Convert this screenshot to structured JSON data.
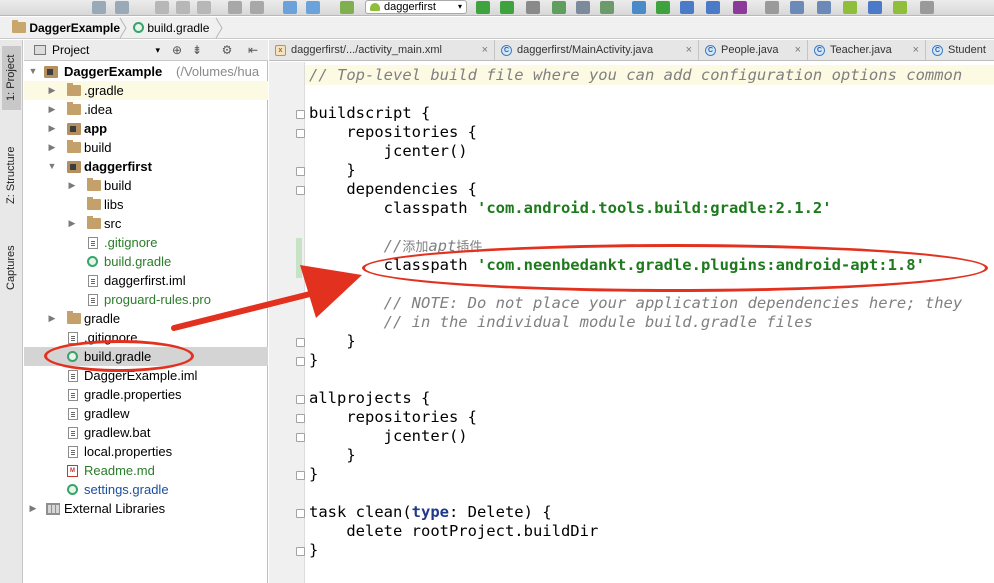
{
  "toolbar": {
    "run_config": "daggerfirst"
  },
  "breadcrumb": {
    "items": [
      "DaggerExample",
      "build.gradle"
    ]
  },
  "tool_strip": {
    "tabs": [
      "1: Project",
      "Z: Structure",
      "Captures"
    ]
  },
  "project_panel": {
    "view_selector": "Project",
    "tree": [
      {
        "label": "DaggerExample",
        "detail": "(/Volumes/hua",
        "icon": "module-folder-icon"
      },
      {
        "label": ".gradle",
        "icon": "folder-icon"
      },
      {
        "label": ".idea",
        "icon": "folder-icon"
      },
      {
        "label": "app",
        "icon": "module-folder-icon"
      },
      {
        "label": "build",
        "icon": "folder-icon"
      },
      {
        "label": "daggerfirst",
        "icon": "module-folder-icon"
      },
      {
        "label": "build",
        "icon": "folder-icon"
      },
      {
        "label": "libs",
        "icon": "folder-icon"
      },
      {
        "label": "src",
        "icon": "folder-icon"
      },
      {
        "label": ".gitignore",
        "icon": "file-icon"
      },
      {
        "label": "build.gradle",
        "icon": "gradle-icon"
      },
      {
        "label": "daggerfirst.iml",
        "icon": "file-icon"
      },
      {
        "label": "proguard-rules.pro",
        "icon": "file-icon"
      },
      {
        "label": "gradle",
        "icon": "folder-icon"
      },
      {
        "label": ".gitignore",
        "icon": "file-icon"
      },
      {
        "label": "build.gradle",
        "icon": "gradle-icon"
      },
      {
        "label": "DaggerExample.iml",
        "icon": "file-icon"
      },
      {
        "label": "gradle.properties",
        "icon": "file-icon"
      },
      {
        "label": "gradlew",
        "icon": "file-icon"
      },
      {
        "label": "gradlew.bat",
        "icon": "file-icon"
      },
      {
        "label": "local.properties",
        "icon": "file-icon"
      },
      {
        "label": "Readme.md",
        "icon": "markdown-icon"
      },
      {
        "label": "settings.gradle",
        "icon": "gradle-icon"
      },
      {
        "label": "External Libraries",
        "icon": "libraries-icon"
      }
    ]
  },
  "editor_tabs": [
    {
      "label": "daggerfirst/.../activity_main.xml",
      "icon": "xml-file-icon"
    },
    {
      "label": "daggerfirst/MainActivity.java",
      "icon": "class-icon"
    },
    {
      "label": "People.java",
      "icon": "class-icon"
    },
    {
      "label": "Teacher.java",
      "icon": "class-icon"
    },
    {
      "label": "Student",
      "icon": "class-icon"
    }
  ],
  "code": {
    "l1": "// Top-level build file where you can add configuration options common",
    "l3": "buildscript {",
    "l4": "    repositories {",
    "l5": "        jcenter()",
    "l6": "    }",
    "l7": "    dependencies {",
    "l8a": "        classpath ",
    "l8b": "'com.android.tools.build:gradle:2.1.2'",
    "l10a": "        //",
    "l10b": "添加",
    "l10c": "apt",
    "l10d": "插件",
    "l11a": "        classpath ",
    "l11b": "'com.neenbedankt.gradle.plugins:android-apt:1.8'",
    "l13": "        // NOTE: Do not place your application dependencies here; they",
    "l14": "        // in the individual module build.gradle files",
    "l15": "    }",
    "l16": "}",
    "l18": "allprojects {",
    "l19": "    repositories {",
    "l20": "        jcenter()",
    "l21": "    }",
    "l22": "}",
    "l24a": "task clean(",
    "l24b": "type",
    "l24c": ": Delete) {",
    "l25": "    delete rootProject.buildDir",
    "l26": "}"
  },
  "colors": {
    "annotation": "#e2321f",
    "string": "#1d7a1d",
    "comment": "#808080",
    "keyword": "#1f3a8a"
  }
}
